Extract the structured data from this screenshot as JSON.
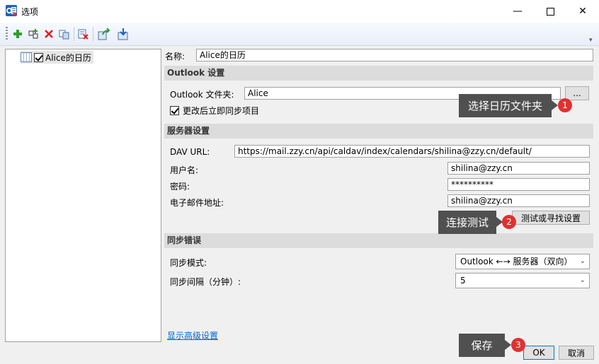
{
  "window": {
    "title": "选项",
    "app_icon_text": "O"
  },
  "toolbar": {
    "items": [
      "add-icon",
      "add-multiple-icon",
      "delete-icon",
      "copy-icon",
      "clear-cache-icon",
      "export-icon",
      "import-icon"
    ]
  },
  "tree": {
    "item_label": "Alice的日历",
    "checked": true
  },
  "form": {
    "name_label": "名称:",
    "name_value": "Alice的日历",
    "outlook_section": "Outlook 设置",
    "folder_label": "Outlook 文件夹:",
    "folder_value": "Alice",
    "browse_label": "...",
    "sync_immediately_label": "更改后立即同步项目",
    "server_section": "服务器设置",
    "dav_label": "DAV URL:",
    "dav_value": "https://mail.zzy.cn/api/caldav/index/calendars/shilina@zzy.cn/default/",
    "username_label": "用户名:",
    "username_value": "shilina@zzy.cn",
    "password_label": "密码:",
    "password_value": "**********",
    "email_label": "电子邮件地址:",
    "email_value": "shilina@zzy.cn",
    "test_button": "测试或寻找设置",
    "sync_section": "同步错误",
    "mode_label": "同步模式:",
    "mode_value": "Outlook ←→ 服务器（双向）",
    "interval_label": "同步间隔（分钟）:",
    "interval_value": "5",
    "advanced_link": "显示高级设置"
  },
  "footer": {
    "ok": "OK",
    "cancel": "取消"
  },
  "callouts": [
    {
      "text": "选择日历文件夹",
      "badge": "1"
    },
    {
      "text": "连接测试",
      "badge": "2"
    },
    {
      "text": "保存",
      "badge": "3"
    }
  ],
  "colors": {
    "callout_bg": "#505050",
    "badge": "#e03131",
    "link": "#0066cc",
    "section_bg": "#dcdcdc"
  }
}
